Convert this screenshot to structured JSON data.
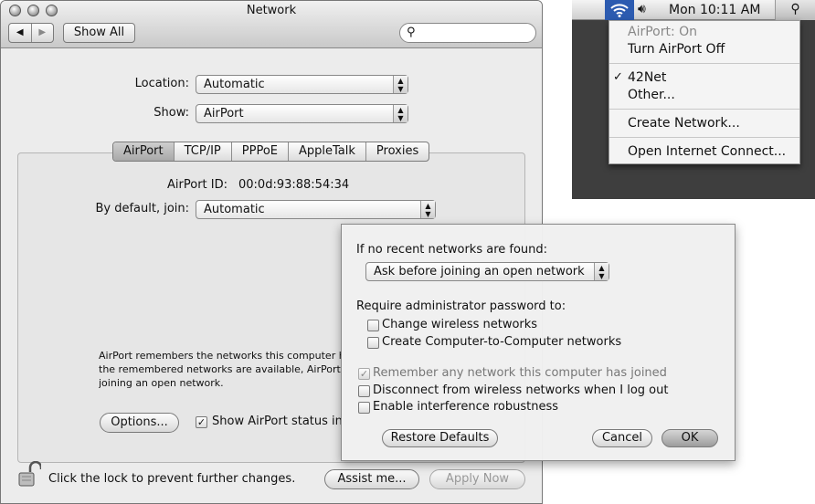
{
  "window": {
    "title": "Network",
    "show_all": "Show All",
    "search_placeholder": ""
  },
  "location": {
    "label": "Location:",
    "value": "Automatic"
  },
  "show": {
    "label": "Show:",
    "value": "AirPort"
  },
  "tabs": [
    {
      "label": "AirPort"
    },
    {
      "label": "TCP/IP"
    },
    {
      "label": "PPPoE"
    },
    {
      "label": "AppleTalk"
    },
    {
      "label": "Proxies"
    }
  ],
  "airport": {
    "id_label": "AirPort ID:",
    "id_value": "00:0d:93:88:54:34",
    "join_label": "By default, join:",
    "join_value": "Automatic",
    "info_line1": "AirPort remembers the networks this computer has joined. If none of",
    "info_line2": "the remembered networks are available, AirPort will ask before",
    "info_line3": "joining an open network.",
    "options_button": "Options...",
    "show_status_label": "Show AirPort status in menu bar",
    "help_icon": "question-icon"
  },
  "footer": {
    "lock_text": "Click the lock to prevent further changes.",
    "assist_button": "Assist me...",
    "apply_button": "Apply Now"
  },
  "menubar": {
    "clock": "Mon 10:11 AM"
  },
  "airport_menu": {
    "status": "AirPort: On",
    "turn_off": "Turn AirPort Off",
    "network_selected": "42Net",
    "other": "Other...",
    "create": "Create Network...",
    "open_ic": "Open Internet Connect..."
  },
  "sheet": {
    "if_none_label": "If no recent networks are found:",
    "if_none_value": "Ask before joining an open network",
    "require_label": "Require administrator password to:",
    "opt_change": "Change wireless networks",
    "opt_create": "Create Computer-to-Computer networks",
    "opt_remember": "Remember any network this computer has joined",
    "opt_disconnect": "Disconnect from wireless networks when I log out",
    "opt_interference": "Enable interference robustness",
    "restore_button": "Restore Defaults",
    "cancel_button": "Cancel",
    "ok_button": "OK"
  },
  "checkbox_states": {
    "show_status": true,
    "change_wireless": false,
    "create_c2c": false,
    "remember_any": true,
    "disconnect_logout": false,
    "interference": false
  }
}
